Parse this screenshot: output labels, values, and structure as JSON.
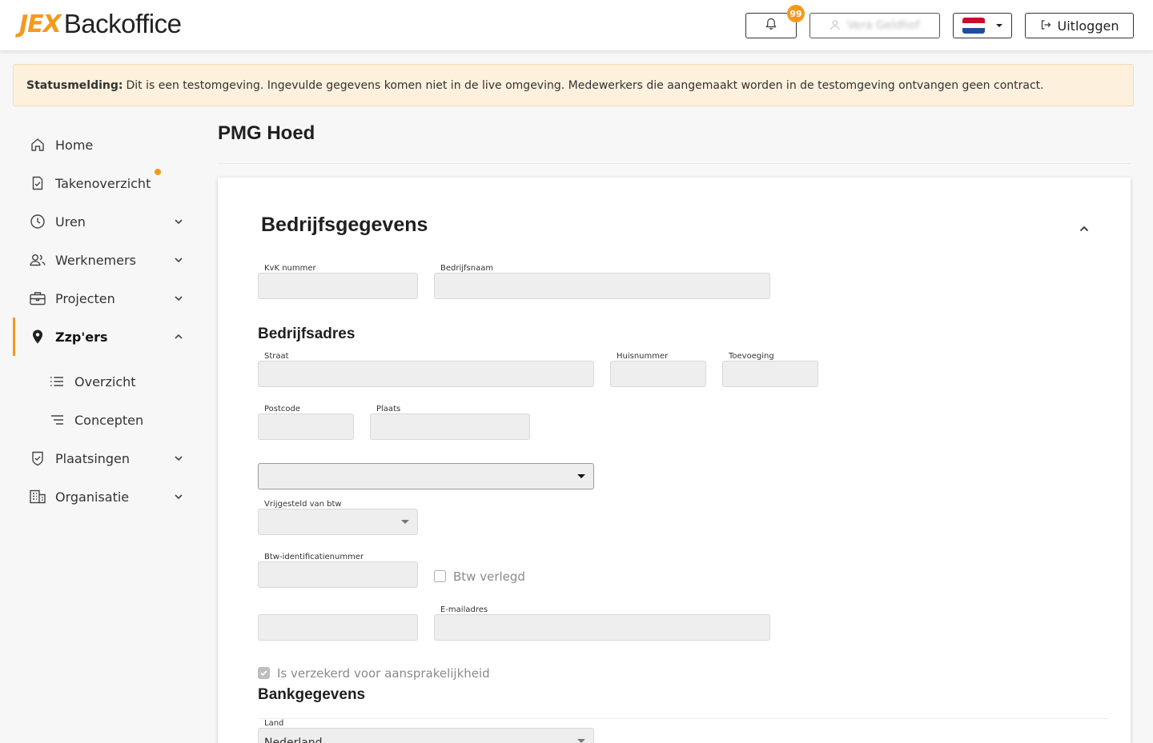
{
  "header": {
    "logo_prefix": "JEX",
    "logo_text": "Backoffice",
    "notification_count": "99",
    "user_name": "Vera Geldhof",
    "logout_label": "Uitloggen"
  },
  "banner": {
    "label": "Statusmelding:",
    "text": "Dit is een testomgeving. Ingevulde gegevens komen niet in de live omgeving. Medewerkers die aangemaakt worden in de testomgeving ontvangen geen contract."
  },
  "sidebar": {
    "items": [
      {
        "label": "Home"
      },
      {
        "label": "Takenoverzicht"
      },
      {
        "label": "Uren"
      },
      {
        "label": "Werknemers"
      },
      {
        "label": "Projecten"
      },
      {
        "label": "Zzp'ers"
      },
      {
        "label": "Overzicht"
      },
      {
        "label": "Concepten"
      },
      {
        "label": "Plaatsingen"
      },
      {
        "label": "Organisatie"
      }
    ]
  },
  "page": {
    "title": "PMG Hoed"
  },
  "form": {
    "section_title": "Bedrijfsgegevens",
    "kvk_label": "KvK nummer",
    "bedrijfsnaam_label": "Bedrijfsnaam",
    "address_title": "Bedrijfsadres",
    "straat_label": "Straat",
    "huisnummer_label": "Huisnummer",
    "toevoeging_label": "Toevoeging",
    "postcode_label": "Postcode",
    "plaats_label": "Plaats",
    "vrijgesteld_label": "Vrijgesteld van btw",
    "btw_id_label": "Btw-identificatienummer",
    "btw_verlegd_label": "Btw verlegd",
    "email_label": "E-mailadres",
    "verzekerd_label": "Is verzekerd voor aansprakelijkheid",
    "bank_title": "Bankgegevens",
    "land_label": "Land",
    "land_value": "Nederland"
  },
  "colors": {
    "accent": "#f39a1e",
    "banner_bg": "#fdf0dc"
  }
}
